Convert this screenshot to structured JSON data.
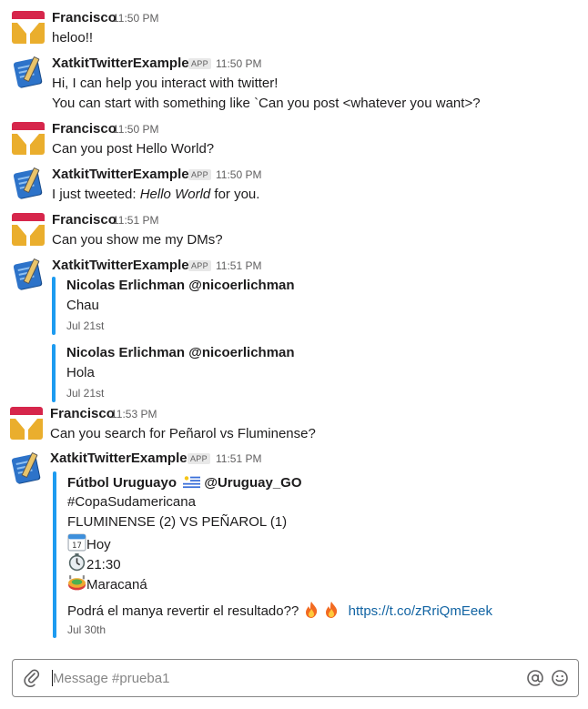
{
  "messages": [
    {
      "author": "Francisco",
      "time": "11:50 PM",
      "lines": [
        "heloo!!"
      ]
    },
    {
      "author": "XatkitTwitterExample",
      "badge": "APP",
      "time": "11:50 PM",
      "lines": [
        "Hi, I can help you interact with twitter!",
        "You can start with something like `Can you post <whatever you want>?"
      ]
    },
    {
      "author": "Francisco",
      "time": "11:50 PM",
      "lines": [
        "Can you post Hello World?"
      ]
    },
    {
      "author": "XatkitTwitterExample",
      "badge": "APP",
      "time": "11:50 PM",
      "pre": "I just tweeted: ",
      "em": "Hello World",
      "post": " for you."
    },
    {
      "author": "Francisco",
      "time": "11:51 PM",
      "lines": [
        "Can you show me my DMs?"
      ]
    },
    {
      "author": "XatkitTwitterExample",
      "badge": "APP",
      "time": "11:51 PM",
      "attachments": [
        {
          "title": "Nicolas Erlichman @nicoerlichman",
          "text": "Chau",
          "date": "Jul 21st"
        },
        {
          "title": "Nicolas Erlichman @nicoerlichman",
          "text": "Hola",
          "date": "Jul 21st"
        }
      ]
    },
    {
      "author": "Francisco",
      "time": "11:53 PM",
      "lines": [
        "Can you search for Peñarol vs Fluminense?"
      ]
    },
    {
      "author": "XatkitTwitterExample",
      "badge": "APP",
      "time": "11:51 PM",
      "tweet": {
        "title_a": "Fútbol Uruguayo",
        "title_b": "@Uruguay_GO",
        "hashtag": "#CopaSudamericana",
        "score": "FLUMINENSE (2) VS PEÑAROL (1)",
        "day": "Hoy",
        "hour": "21:30",
        "place": "Maracaná",
        "question": "Podrá el manya revertir el resultado?? ",
        "link": "https://t.co/zRriQmEeek",
        "date": "Jul 30th",
        "icons": [
          "calendar-icon",
          "alarm-clock-icon",
          "stadium-icon",
          "fire-icon",
          "uruguay-flag-icon"
        ]
      }
    }
  ],
  "composer": {
    "placeholder": "Message #prueba1",
    "icons": [
      "paperclip-icon",
      "mention-icon",
      "emoji-icon"
    ]
  },
  "colors": {
    "accent": "#1d9bf0",
    "link": "#1264a3",
    "avatar_red": "#d6264b",
    "avatar_yellow": "#eaae2d"
  }
}
